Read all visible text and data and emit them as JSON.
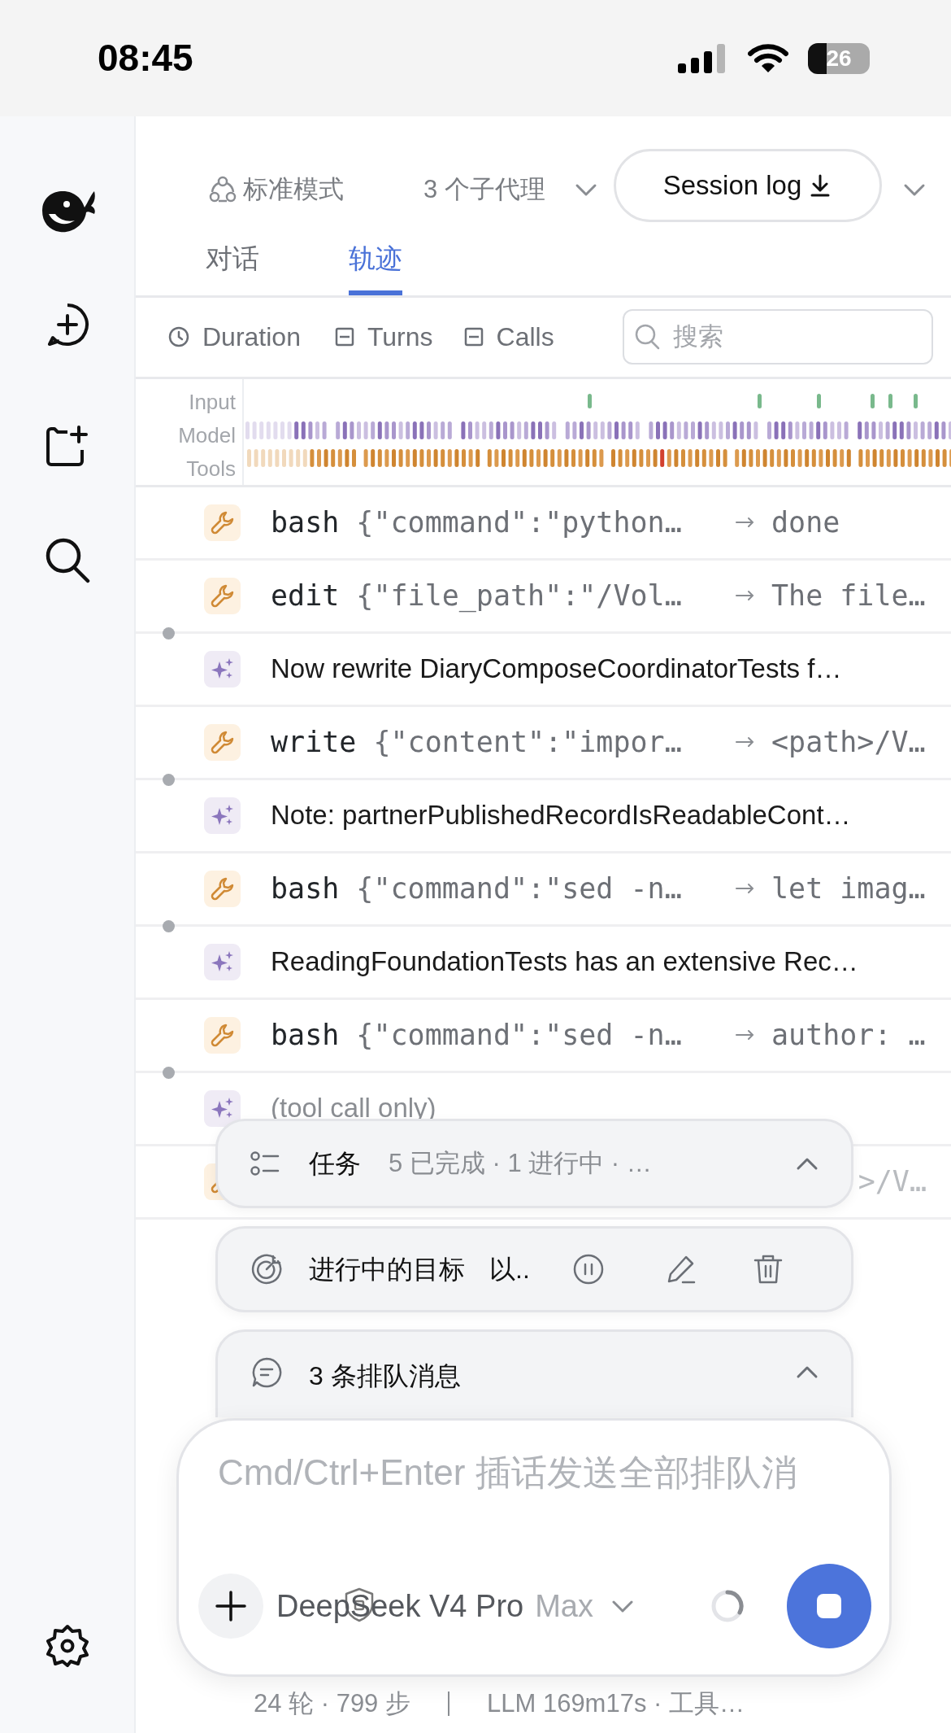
{
  "status_bar": {
    "time": "08:45",
    "battery": "26"
  },
  "header": {
    "mode": "标准模式",
    "subagents": "3 个子代理",
    "session_log_button": "Session log"
  },
  "tabs": [
    {
      "label": "对话",
      "selected": false
    },
    {
      "label": "轨迹",
      "selected": true
    }
  ],
  "toolbar": {
    "filters": [
      {
        "label": "Duration",
        "kind": "clock"
      },
      {
        "label": "Turns",
        "kind": "group"
      },
      {
        "label": "Calls",
        "kind": "group"
      }
    ],
    "search": {
      "placeholder": "搜索"
    }
  },
  "timeline": {
    "lanes": [
      "Input",
      "Model",
      "Tools"
    ]
  },
  "rows": [
    {
      "kind": "tool",
      "name": "bash",
      "args": "{\"command\":\"python…",
      "result": "done"
    },
    {
      "kind": "tool",
      "name": "edit",
      "args": "{\"file_path\":\"/Vol…",
      "result": "The file…"
    },
    {
      "kind": "assistant",
      "text": "Now rewrite DiaryComposeCoordinatorTests f…",
      "muted": false
    },
    {
      "kind": "tool",
      "name": "write",
      "args": "{\"content\":\"impor…",
      "result": "<path>/V…"
    },
    {
      "kind": "assistant",
      "text": "Note: partnerPublishedRecordIsReadableCont…",
      "muted": false
    },
    {
      "kind": "tool",
      "name": "bash",
      "args": "{\"command\":\"sed -n…",
      "result": "let imag…"
    },
    {
      "kind": "assistant",
      "text": "ReadingFoundationTests has an extensive Rec…",
      "muted": false
    },
    {
      "kind": "tool",
      "name": "bash",
      "args": "{\"command\":\"sed -n…",
      "result": "author: …"
    },
    {
      "kind": "assistant",
      "text": "(tool call only)",
      "muted": true
    },
    {
      "kind": "tool",
      "result": ">/V…"
    }
  ],
  "tasks_panel": {
    "title": "任务",
    "summary": "5 已完成 · 1 进行中 · …"
  },
  "goal_panel": {
    "title": "进行中的目标",
    "text": "以.."
  },
  "queue_panel": {
    "title": "3 条排队消息"
  },
  "composer": {
    "placeholder": "Cmd/Ctrl+Enter 插话发送全部排队消",
    "model": "DeepSeek V4 Pro",
    "effort": "Max"
  },
  "footer": [
    "24 轮 · 799 步",
    "LLM 169m17s · 工具…"
  ]
}
